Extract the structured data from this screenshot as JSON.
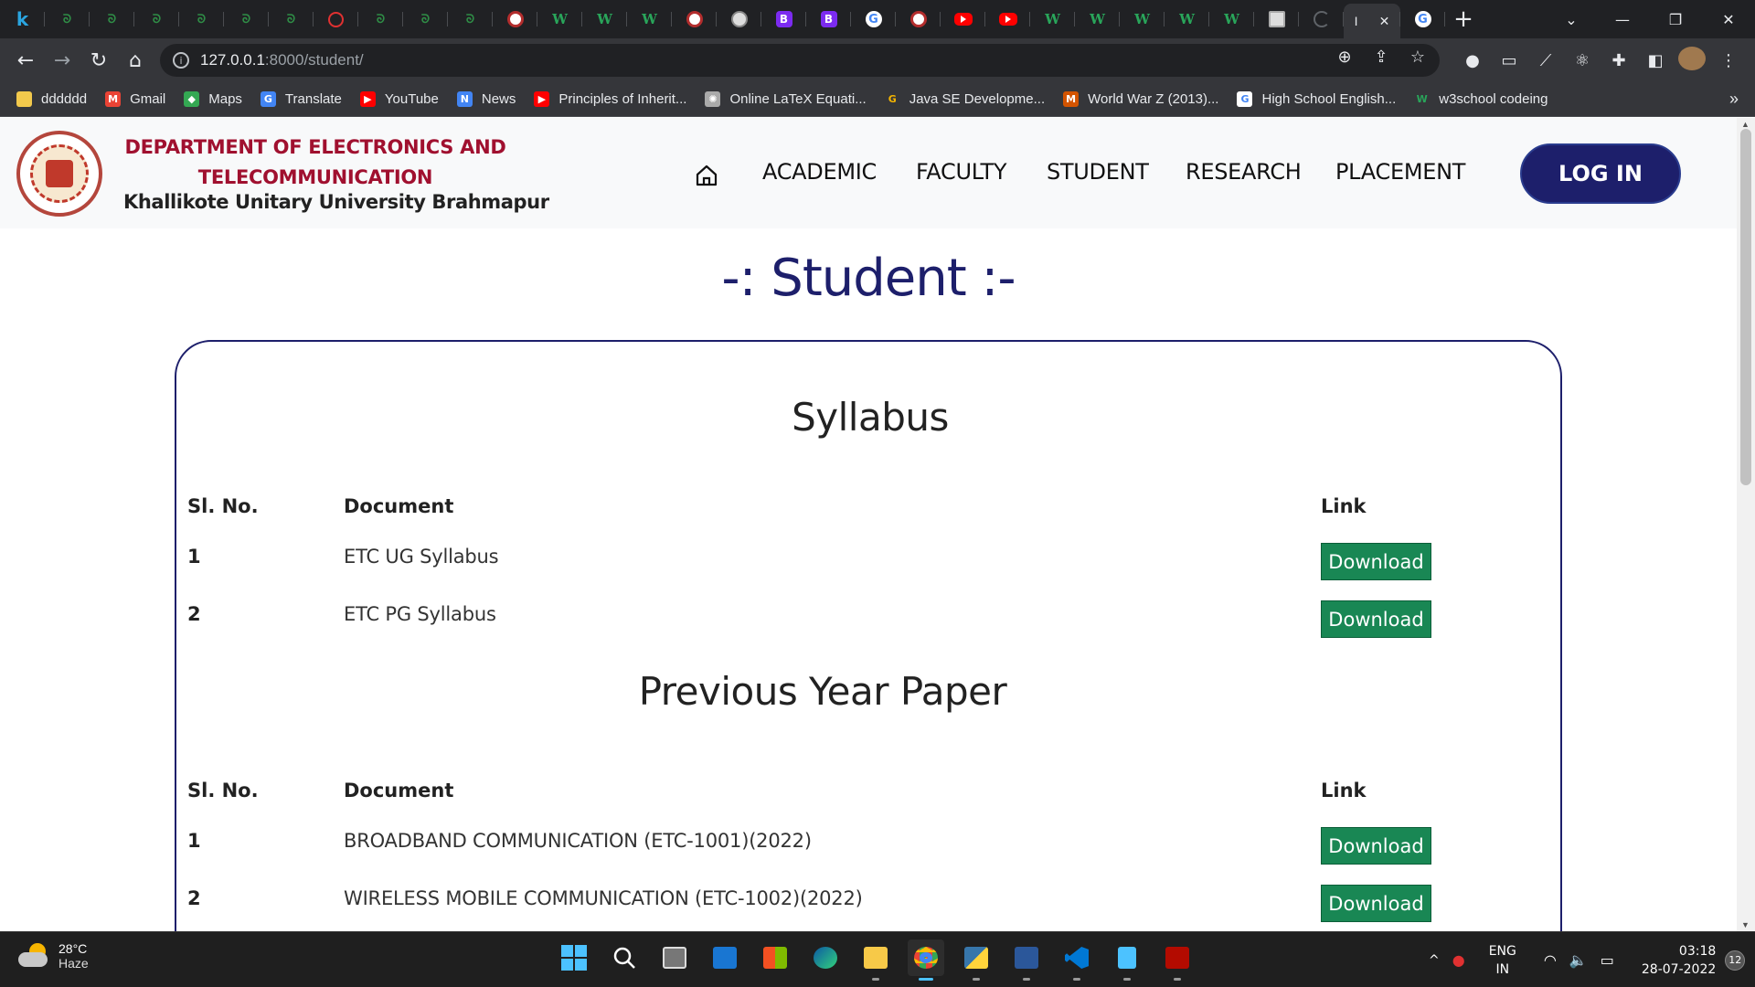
{
  "browser": {
    "tabs": [
      {
        "icon": "kaggle-icon",
        "glyph": "k"
      },
      {
        "icon": "geeksforgeeks-icon",
        "glyph": "ᘐ"
      },
      {
        "icon": "geeksforgeeks-icon",
        "glyph": "ᘐ"
      },
      {
        "icon": "geeksforgeeks-icon",
        "glyph": "ᘐ"
      },
      {
        "icon": "geeksforgeeks-icon",
        "glyph": "ᘐ"
      },
      {
        "icon": "geeksforgeeks-icon",
        "glyph": "ᘐ"
      },
      {
        "icon": "geeksforgeeks-icon",
        "glyph": "ᘐ"
      },
      {
        "icon": "quora-icon",
        "glyph": "Q"
      },
      {
        "icon": "geeksforgeeks-icon",
        "glyph": "ᘐ"
      },
      {
        "icon": "geeksforgeeks-icon",
        "glyph": "ᘐ"
      },
      {
        "icon": "geeksforgeeks-icon",
        "glyph": "ᘐ"
      },
      {
        "icon": "university-seal-icon",
        "glyph": ""
      },
      {
        "icon": "w3schools-icon",
        "glyph": "W"
      },
      {
        "icon": "w3schools-icon",
        "glyph": "W"
      },
      {
        "icon": "w3schools-icon",
        "glyph": "W"
      },
      {
        "icon": "university-seal-icon",
        "glyph": ""
      },
      {
        "icon": "globe-icon",
        "glyph": ""
      },
      {
        "icon": "bootstrap-icon",
        "glyph": "B"
      },
      {
        "icon": "bootstrap-icon",
        "glyph": "B"
      },
      {
        "icon": "google-icon",
        "glyph": "G"
      },
      {
        "icon": "target-icon",
        "glyph": ""
      },
      {
        "icon": "youtube-icon",
        "glyph": ""
      },
      {
        "icon": "youtube-icon",
        "glyph": ""
      },
      {
        "icon": "w3schools-icon",
        "glyph": "W"
      },
      {
        "icon": "w3schools-icon",
        "glyph": "W"
      },
      {
        "icon": "w3schools-icon",
        "glyph": "W"
      },
      {
        "icon": "w3schools-icon",
        "glyph": "W"
      },
      {
        "icon": "w3schools-icon",
        "glyph": "W"
      },
      {
        "icon": "image-icon",
        "glyph": ""
      },
      {
        "icon": "loading-icon",
        "glyph": ""
      }
    ],
    "active_tab": {
      "label": "I",
      "close": "✕"
    },
    "google_tab_glyph": "G",
    "new_tab": "+",
    "window_controls": {
      "menu": "⌄",
      "minimize": "—",
      "restore": "❐",
      "close": "✕"
    },
    "nav": {
      "back": "←",
      "forward": "→",
      "reload": "↻",
      "home": "⌂"
    },
    "url": {
      "info": "i",
      "host": "127.0.0.1",
      "path": ":8000/student/"
    },
    "omnibox_icons": {
      "zoom": "⊕",
      "share": "⇪",
      "star": "☆"
    },
    "extension_icons": [
      "●",
      "▭",
      "⟋",
      "⚛",
      "✚",
      "◧"
    ],
    "menu": "⋮",
    "bookmarks": [
      {
        "label": "dddddd",
        "icon": "folder-icon",
        "color": "#f2c94c",
        "glyph": ""
      },
      {
        "label": "Gmail",
        "icon": "gmail-icon",
        "color": "#ea4335",
        "glyph": "M"
      },
      {
        "label": "Maps",
        "icon": "maps-icon",
        "color": "#34a853",
        "glyph": "◆"
      },
      {
        "label": "Translate",
        "icon": "translate-icon",
        "color": "#4285f4",
        "glyph": "G"
      },
      {
        "label": "YouTube",
        "icon": "youtube-icon",
        "color": "#ff0000",
        "glyph": "▶"
      },
      {
        "label": "News",
        "icon": "news-icon",
        "color": "#4285f4",
        "glyph": "N"
      },
      {
        "label": "Principles of Inherit...",
        "icon": "youtube-icon",
        "color": "#ff0000",
        "glyph": "▶"
      },
      {
        "label": "Online LaTeX Equati...",
        "icon": "gear-icon",
        "color": "#aaaaaa",
        "glyph": "✺"
      },
      {
        "label": "Java SE Developme...",
        "icon": "g-icon",
        "color": "#35363a",
        "glyph": "G"
      },
      {
        "label": "World War Z (2013)...",
        "icon": "movie-icon",
        "color": "#d35400",
        "glyph": "M"
      },
      {
        "label": "High School English...",
        "icon": "google-icon",
        "color": "#ffffff",
        "glyph": "G"
      },
      {
        "label": "w3school codeing",
        "icon": "w3schools-icon",
        "color": "#35363a",
        "glyph": "W"
      }
    ],
    "bookmarks_more": "»"
  },
  "site": {
    "dept_line1": "DEPARTMENT OF ELECTRONICS AND",
    "dept_line2": "TELECOMMUNICATION",
    "university": "Khallikote Unitary University Brahmapur",
    "nav": [
      "ACADEMIC",
      "FACULTY",
      "STUDENT",
      "RESEARCH",
      "PLACEMENT"
    ],
    "login": "LOG IN",
    "page_title": "-: Student :-",
    "syllabus": {
      "title": "Syllabus",
      "headers": [
        "Sl. No.",
        "Document",
        "Link"
      ],
      "rows": [
        {
          "sl": "1",
          "doc": "ETC UG Syllabus",
          "link": "Download"
        },
        {
          "sl": "2",
          "doc": "ETC PG Syllabus",
          "link": "Download"
        }
      ]
    },
    "papers": {
      "title": "Previous Year Paper",
      "headers": [
        "Sl. No.",
        "Document",
        "Link"
      ],
      "rows": [
        {
          "sl": "1",
          "doc": "BROADBAND COMMUNICATION (ETC-1001)(2022)",
          "link": "Download"
        },
        {
          "sl": "2",
          "doc": "WIRELESS MOBILE COMMUNICATION (ETC-1002)(2022)",
          "link": "Download"
        }
      ]
    },
    "colors": {
      "dept": "#a0102f",
      "navy": "#1d1f6b",
      "download": "#198754"
    }
  },
  "taskbar": {
    "weather_temp": "28°C",
    "weather_desc": "Haze",
    "apps": [
      "start",
      "search",
      "task-view",
      "mail",
      "store",
      "edge",
      "file-explorer",
      "chrome",
      "python",
      "word",
      "vscode",
      "notepad",
      "acrobat"
    ],
    "tray": {
      "chevron": "^",
      "lang1": "ENG",
      "lang2": "IN",
      "wifi": "◠",
      "volume": "🔈",
      "battery": "▭",
      "time": "03:18",
      "date": "28-07-2022",
      "notifications": "12"
    }
  }
}
